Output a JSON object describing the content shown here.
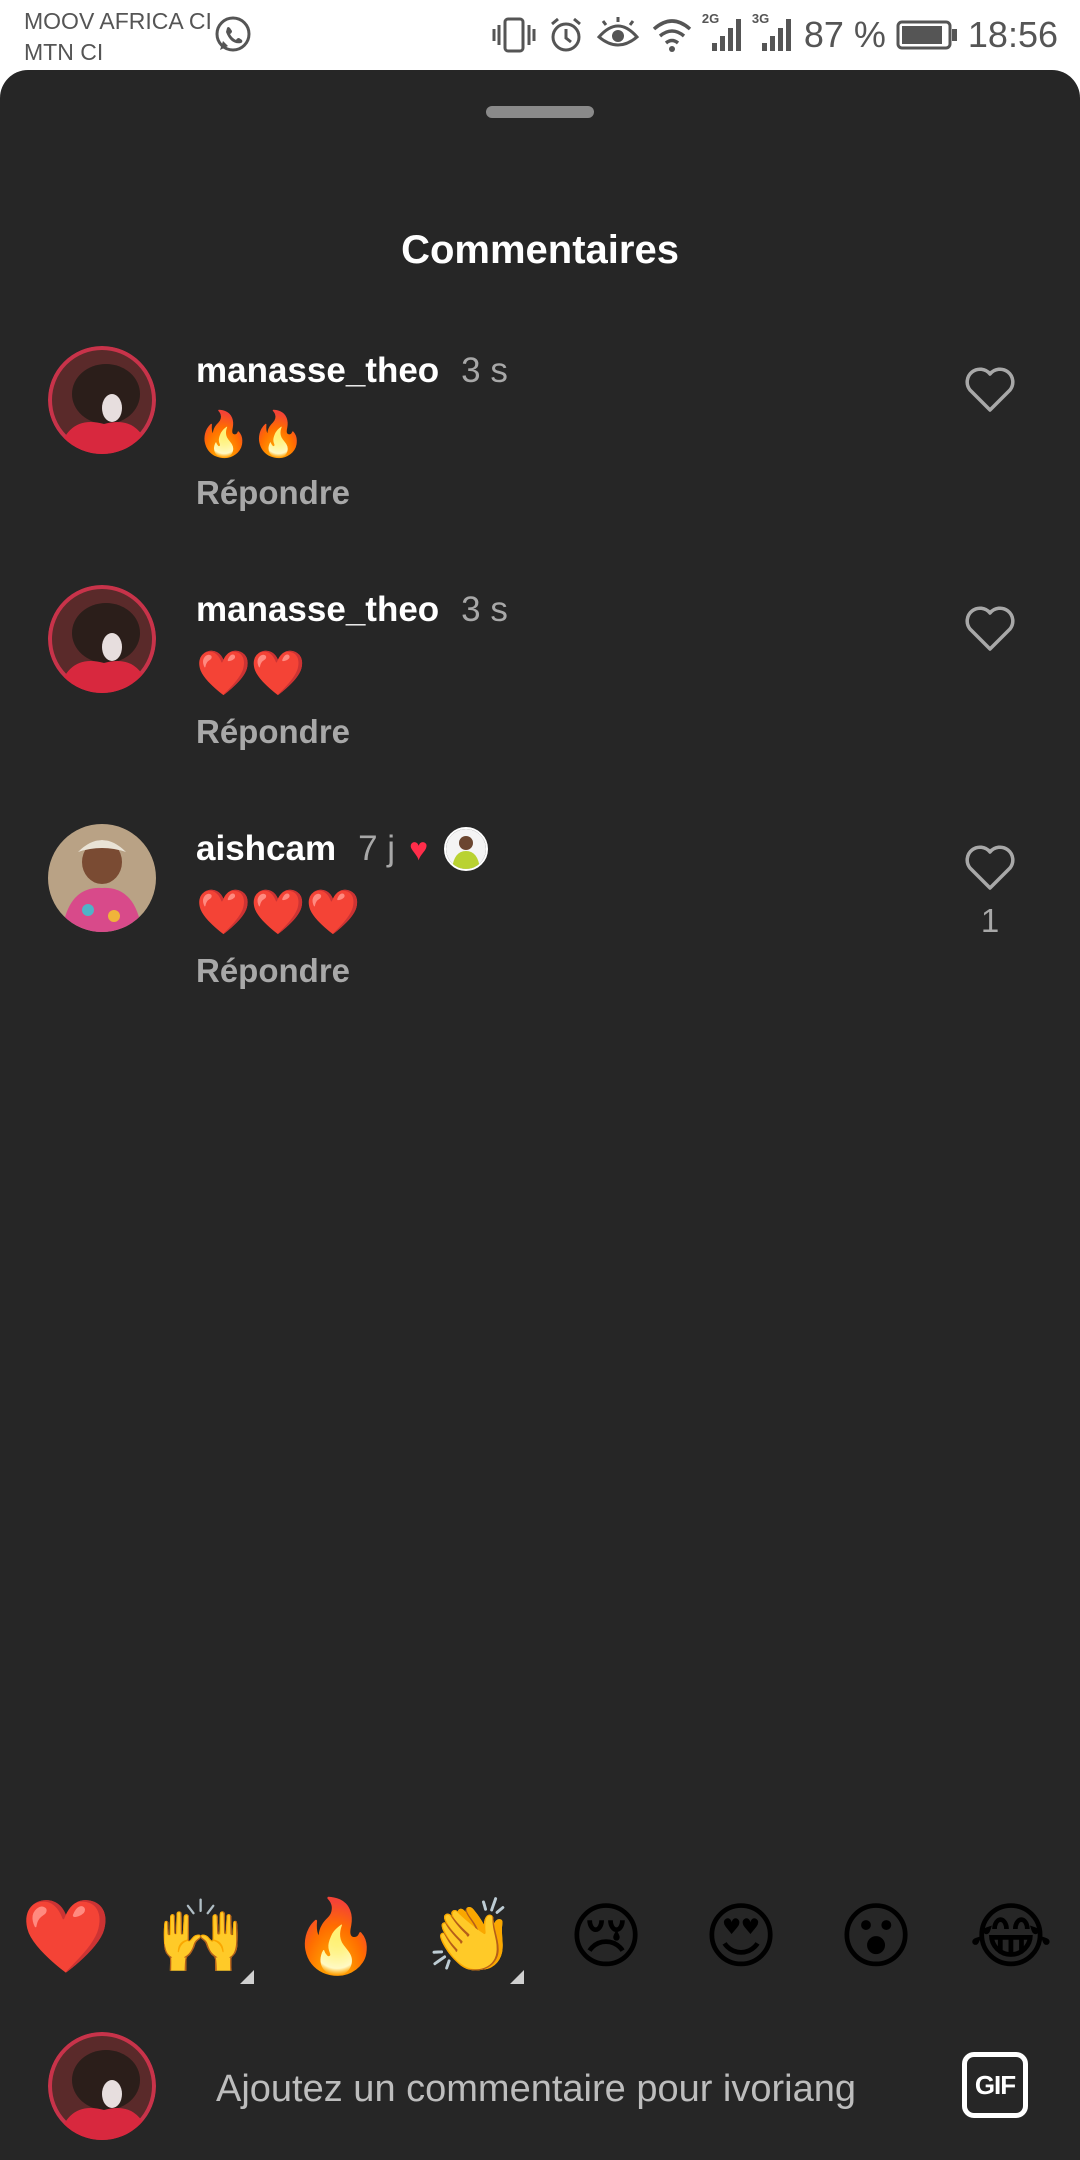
{
  "status_bar": {
    "carrier_1": "MOOV AFRICA CI",
    "carrier_2": "MTN CI",
    "network_1": "2G",
    "network_2": "3G",
    "battery_percent": "87 %",
    "time": "18:56",
    "icons": [
      "whatsapp-icon",
      "vibrate-icon",
      "alarm-icon",
      "eye-icon",
      "wifi-icon",
      "signal-icon",
      "signal-icon",
      "battery-icon"
    ]
  },
  "sheet": {
    "title": "Commentaires"
  },
  "comments": [
    {
      "username": "manasse_theo",
      "time": "3 s",
      "text": "🔥🔥",
      "reply_label": "Répondre",
      "like_count": ""
    },
    {
      "username": "manasse_theo",
      "time": "3 s",
      "text": "❤️❤️",
      "reply_label": "Répondre",
      "like_count": ""
    },
    {
      "username": "aishcam",
      "time": "7 j",
      "creator_liked": true,
      "text": "❤️❤️❤️",
      "reply_label": "Répondre",
      "like_count": "1"
    }
  ],
  "quick_emojis": [
    "❤️",
    "🙌",
    "🔥",
    "👏",
    "😢",
    "😍",
    "😮",
    "😂"
  ],
  "composer": {
    "placeholder": "Ajoutez un commentaire pour ivoriang",
    "gif_label": "GIF"
  },
  "colors": {
    "sheet_background": "#262626",
    "primary_text": "#ffffff",
    "secondary_text": "#a8a8a8",
    "liked_red": "#ff2d4a"
  }
}
